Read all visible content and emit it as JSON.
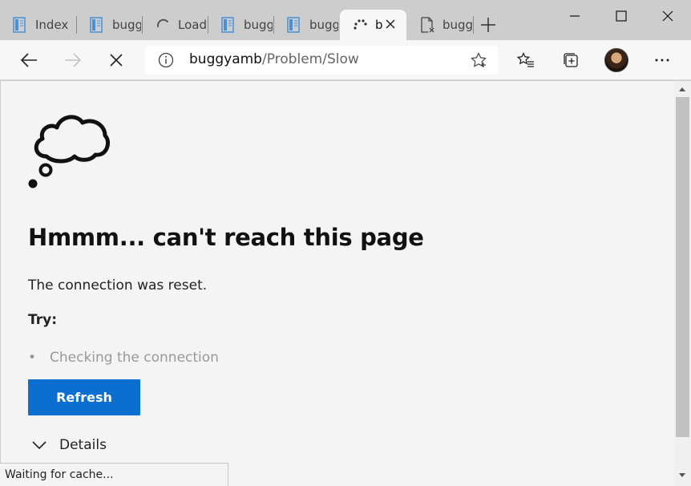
{
  "tabs": [
    {
      "label": "Index",
      "icon": "page-icon"
    },
    {
      "label": "bugg",
      "icon": "page-icon"
    },
    {
      "label": "Loadi",
      "icon": "loading-spinner-icon"
    },
    {
      "label": "bugg",
      "icon": "page-icon"
    },
    {
      "label": "bugg",
      "icon": "page-icon"
    },
    {
      "label": "b",
      "icon": "loading-spinner-icon",
      "active": true
    },
    {
      "label": "bugg",
      "icon": "broken-page-icon"
    }
  ],
  "address": {
    "host": "buggyamb",
    "path": "/Problem/Slow"
  },
  "error": {
    "heading": "Hmmm... can't reach this page",
    "message": "The connection was reset.",
    "try_label": "Try:",
    "suggestions": [
      "Checking the connection"
    ],
    "refresh_label": "Refresh",
    "details_label": "Details"
  },
  "status": {
    "text": "Waiting for cache..."
  },
  "colors": {
    "accent": "#0a6fd0",
    "tabstrip": "#cdcdcd",
    "page_bg": "#f4f4f4"
  }
}
